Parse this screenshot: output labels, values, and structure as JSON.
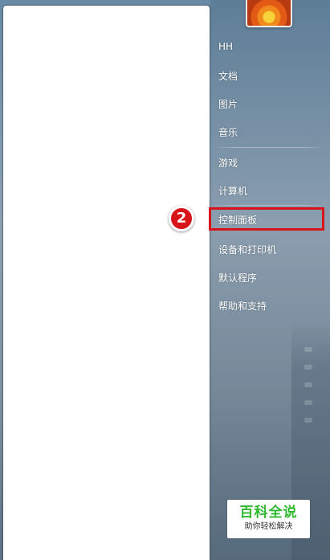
{
  "menu_items": [
    {
      "label": "HH"
    },
    {
      "label": "文档"
    },
    {
      "label": "图片"
    },
    {
      "label": "音乐"
    },
    {
      "label": "游戏"
    },
    {
      "label": "计算机"
    },
    {
      "label": "控制面板"
    },
    {
      "label": "设备和打印机"
    },
    {
      "label": "默认程序"
    },
    {
      "label": "帮助和支持"
    }
  ],
  "annotation": {
    "step_number": "2",
    "highlight_color": "#d8141a"
  },
  "watermark": {
    "title": "百科全说",
    "subtitle": "助你轻松解决",
    "color": "#2eb82e"
  },
  "user_picture": {
    "icon": "flower-icon"
  }
}
